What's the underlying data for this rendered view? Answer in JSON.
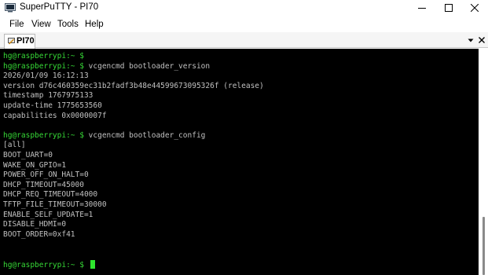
{
  "window": {
    "title": "SuperPuTTY - PI70",
    "icon": "superputty-app-icon",
    "controls": [
      "minimize-icon",
      "maximize-icon",
      "close-icon"
    ]
  },
  "menu": {
    "items": [
      {
        "label": "File"
      },
      {
        "label": "View"
      },
      {
        "label": "Tools"
      },
      {
        "label": "Help"
      }
    ]
  },
  "tabs": [
    {
      "label": "PI70",
      "icon": "putty-session-icon",
      "active": true
    }
  ],
  "tabstrip_controls": [
    "chevron-down-icon",
    "close-icon"
  ],
  "terminal": {
    "colors": {
      "background": "#000000",
      "text": "#c0c0c0",
      "prompt": "#36d936",
      "cursor": "#2ee62e"
    },
    "lines": [
      {
        "prompt": "hg@raspberrypi:~ $",
        "text": ""
      },
      {
        "prompt": "hg@raspberrypi:~ $",
        "text": " vcgencmd bootloader_version"
      },
      {
        "prompt": "",
        "text": "2026/01/09 16:12:13"
      },
      {
        "prompt": "",
        "text": "version d76c460359ec31b2fadf3b48e44599673095326f (release)"
      },
      {
        "prompt": "",
        "text": "timestamp 1767975133"
      },
      {
        "prompt": "",
        "text": "update-time 1775653560"
      },
      {
        "prompt": "",
        "text": "capabilities 0x0000007f"
      },
      {
        "prompt": "",
        "text": ""
      },
      {
        "prompt": "hg@raspberrypi:~ $",
        "text": " vcgencmd bootloader_config"
      },
      {
        "prompt": "",
        "text": "[all]"
      },
      {
        "prompt": "",
        "text": "BOOT_UART=0"
      },
      {
        "prompt": "",
        "text": "WAKE_ON_GPIO=1"
      },
      {
        "prompt": "",
        "text": "POWER_OFF_ON_HALT=0"
      },
      {
        "prompt": "",
        "text": "DHCP_TIMEOUT=45000"
      },
      {
        "prompt": "",
        "text": "DHCP_REQ_TIMEOUT=4000"
      },
      {
        "prompt": "",
        "text": "TFTP_FILE_TIMEOUT=30000"
      },
      {
        "prompt": "",
        "text": "ENABLE_SELF_UPDATE=1"
      },
      {
        "prompt": "",
        "text": "DISABLE_HDMI=0"
      },
      {
        "prompt": "",
        "text": "BOOT_ORDER=0xf41"
      },
      {
        "prompt": "",
        "text": ""
      },
      {
        "prompt": "",
        "text": ""
      },
      {
        "prompt": "hg@raspberrypi:~ $",
        "text": " ",
        "cursor": true
      }
    ]
  }
}
